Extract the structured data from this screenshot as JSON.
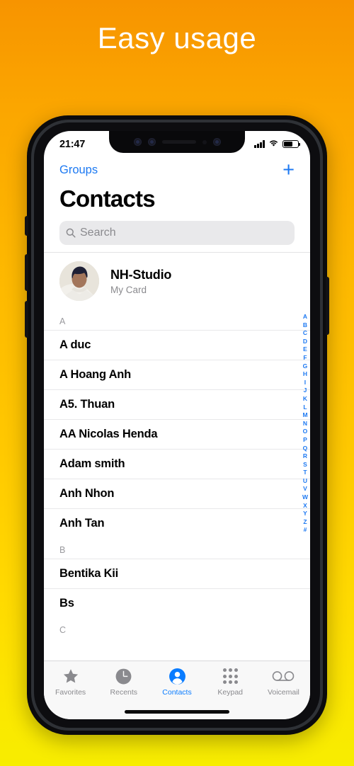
{
  "headline": "Easy usage",
  "theme": {
    "bg_top": "#F79400",
    "bg_bottom": "#F7ED00",
    "accent_blue": "#1D79F2",
    "tab_active": "#0A7CFF",
    "muted_gray": "#8A8A8E"
  },
  "status_bar": {
    "time": "21:47",
    "signal_icon": "cellular-bars-icon",
    "wifi_icon": "wifi-icon",
    "battery_icon": "battery-icon",
    "battery_level": 62
  },
  "nav": {
    "groups_label": "Groups",
    "add_label": "+",
    "title": "Contacts"
  },
  "search": {
    "placeholder": "Search",
    "value": "",
    "icon": "search-icon"
  },
  "my_card": {
    "name": "NH-Studio",
    "subtitle": "My Card",
    "avatar_icon": "user-photo-avatar"
  },
  "sections": [
    {
      "letter": "A",
      "contacts": [
        "A duc",
        "A Hoang Anh",
        "A5. Thuan",
        "AA Nicolas Henda",
        "Adam smith",
        "Anh Nhon",
        "Anh Tan"
      ]
    },
    {
      "letter": "B",
      "contacts": [
        "Bentika Kii",
        "Bs"
      ]
    },
    {
      "letter": "C",
      "contacts": []
    }
  ],
  "alpha_index": [
    "A",
    "B",
    "C",
    "D",
    "E",
    "F",
    "G",
    "H",
    "I",
    "J",
    "K",
    "L",
    "M",
    "N",
    "O",
    "P",
    "Q",
    "R",
    "S",
    "T",
    "U",
    "V",
    "W",
    "X",
    "Y",
    "Z",
    "#"
  ],
  "tabs": [
    {
      "label": "Favorites",
      "icon": "star-icon",
      "active": false
    },
    {
      "label": "Recents",
      "icon": "clock-icon",
      "active": false
    },
    {
      "label": "Contacts",
      "icon": "person-circle-icon",
      "active": true
    },
    {
      "label": "Keypad",
      "icon": "keypad-grid-icon",
      "active": false
    },
    {
      "label": "Voicemail",
      "icon": "voicemail-icon",
      "active": false
    }
  ]
}
